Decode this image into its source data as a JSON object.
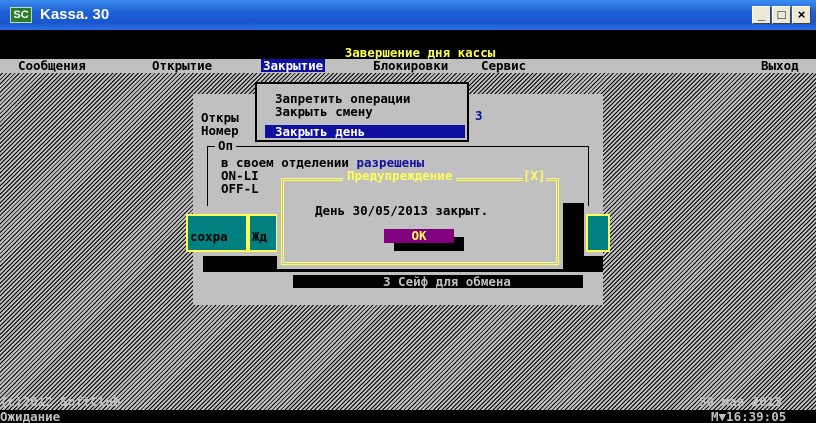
{
  "window": {
    "logo": "SC",
    "title": "Kassa. 30",
    "controls": {
      "minimize": "_",
      "maximize": "□",
      "close": "×"
    }
  },
  "header": {
    "title": "Завершение дня кассы"
  },
  "menu": {
    "items": [
      "Сообщения",
      "Открытие",
      "Закрытие",
      "Блокировки",
      "Сервис"
    ],
    "exit": "Выход"
  },
  "dropdown": {
    "items": [
      "Запретить операции",
      "Закрыть смену",
      "Закрыть день"
    ],
    "selected_index": 2
  },
  "panel": {
    "line1": "Откры",
    "line1_value": "3",
    "line2": "Номер",
    "group_title": "Оп",
    "text_prefix": "в своем отделении ",
    "text_highlight": "разрешены",
    "online": "ON-LI",
    "offline": "OFF-L"
  },
  "buttons": {
    "save": "сохра",
    "wait": "Жд"
  },
  "dialog": {
    "title": "Предупреждение",
    "close": "[X]",
    "message": "День 30/05/2013 закрыт.",
    "ok": "OK"
  },
  "safe_bar": "3 Сейф для обмена",
  "footer": {
    "copyright": "(c)2012 SoftClub",
    "date": "30 мая 2013",
    "status": "Ожидание",
    "clock": "M▼16:39:05"
  },
  "colors": {
    "console_gray": "#c0c0c0",
    "yellow": "#ffff55",
    "dark_blue": "#1010a0",
    "teal": "#008080",
    "magenta": "#800080",
    "titlebar_blue": "#1f5fd6"
  }
}
